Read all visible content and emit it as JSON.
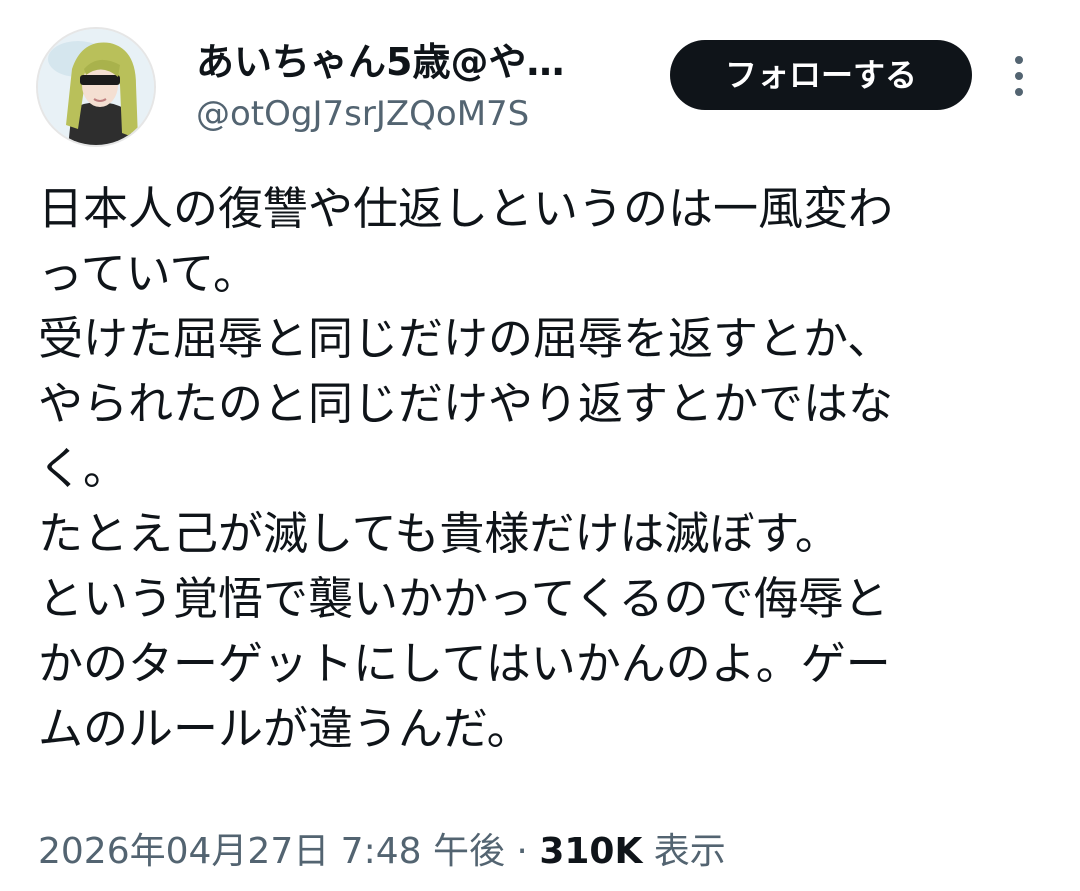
{
  "author": {
    "display_name": "あいちゃん5歳@や…",
    "handle": "@otOgJ7srJZQoM7S",
    "avatar_icon": "anime-character-avatar"
  },
  "actions": {
    "follow_label": "フォローする",
    "more_icon": "more-vertical-icon"
  },
  "tweet": {
    "lines": [
      "日本人の復讐や仕返しというのは一風変わ",
      "っていて。",
      "受けた屈辱と同じだけの屈辱を返すとか、",
      "やられたのと同じだけやり返すとかではな",
      "く。",
      "たとえ己が滅しても貴様だけは滅ぼす。",
      "という覚悟で襲いかかってくるので侮辱と",
      "かのターゲットにしてはいかんのよ。ゲー",
      "ムのルールが違うんだ。"
    ]
  },
  "meta": {
    "timestamp": "2026年04月27日 7:48 午後",
    "separator": " · ",
    "views_count": "310K",
    "views_label": " 表示"
  },
  "colors": {
    "text_primary": "#0f1419",
    "text_secondary": "#536471",
    "button_bg": "#0f1419",
    "button_text": "#ffffff"
  }
}
